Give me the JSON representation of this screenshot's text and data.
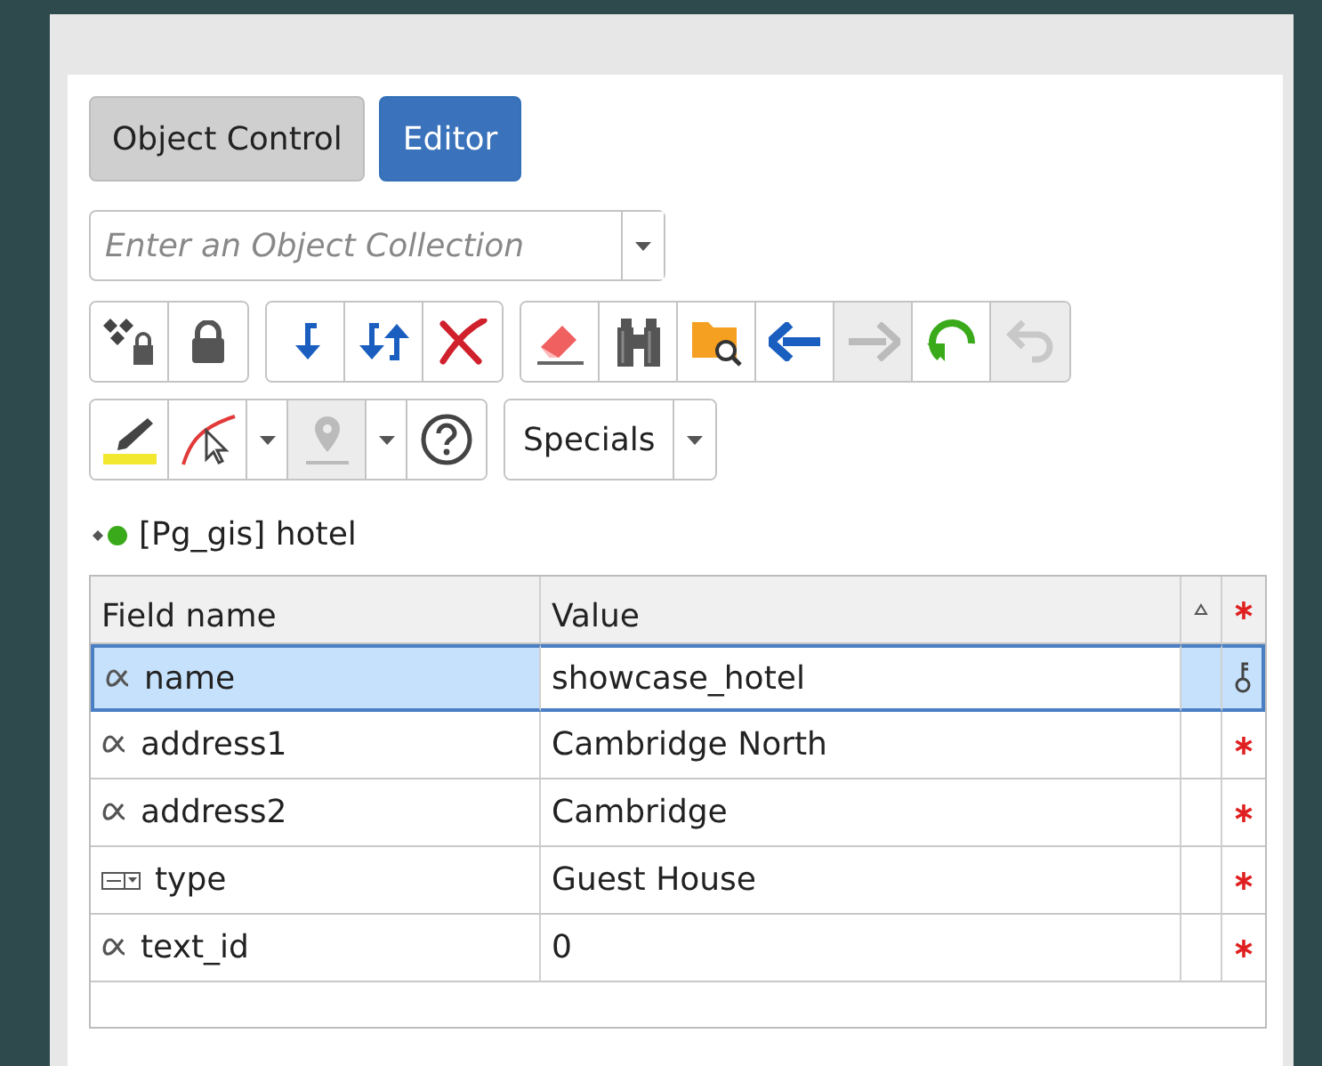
{
  "tabs": [
    {
      "label": "Object Control",
      "selected": false
    },
    {
      "label": "Editor",
      "selected": true
    }
  ],
  "collection": {
    "placeholder": "Enter an Object Collection"
  },
  "toolbar_rows": [
    [
      [
        {
          "kind": "dots-lock",
          "disabled": false
        },
        {
          "kind": "lock",
          "disabled": false
        }
      ],
      [
        {
          "kind": "down-arrow",
          "disabled": false
        },
        {
          "kind": "swap-arrows",
          "disabled": false
        },
        {
          "kind": "cross",
          "disabled": false
        }
      ],
      [
        {
          "kind": "eraser",
          "disabled": false
        },
        {
          "kind": "binoculars",
          "disabled": false
        },
        {
          "kind": "folder-search",
          "disabled": false
        },
        {
          "kind": "back",
          "disabled": false
        },
        {
          "kind": "forward",
          "disabled": true
        },
        {
          "kind": "refresh",
          "disabled": false
        },
        {
          "kind": "undo",
          "disabled": true
        }
      ]
    ],
    [
      [
        {
          "kind": "pen",
          "disabled": false
        },
        {
          "kind": "curve",
          "disabled": false
        },
        {
          "kind": "caret",
          "disabled": false
        },
        {
          "kind": "pin",
          "disabled": true
        },
        {
          "kind": "caret",
          "disabled": false
        },
        {
          "kind": "help",
          "disabled": false
        }
      ]
    ]
  ],
  "specials": {
    "label": "Specials"
  },
  "layer": {
    "label": "[Pg_gis] hotel",
    "color": "#3aaa1a"
  },
  "table": {
    "columns": [
      "Field name",
      "Value"
    ],
    "rows": [
      {
        "kind": "text",
        "field": "name",
        "value": "showcase_hotel",
        "selected": true,
        "key": true,
        "required": false
      },
      {
        "kind": "text",
        "field": "address1",
        "value": "Cambridge North",
        "selected": false,
        "key": false,
        "required": true
      },
      {
        "kind": "text",
        "field": "address2",
        "value": "Cambridge",
        "selected": false,
        "key": false,
        "required": true
      },
      {
        "kind": "list",
        "field": "type",
        "value": "Guest House",
        "selected": false,
        "key": false,
        "required": true
      },
      {
        "kind": "text",
        "field": "text_id",
        "value": "0",
        "selected": false,
        "key": false,
        "required": true
      }
    ]
  }
}
